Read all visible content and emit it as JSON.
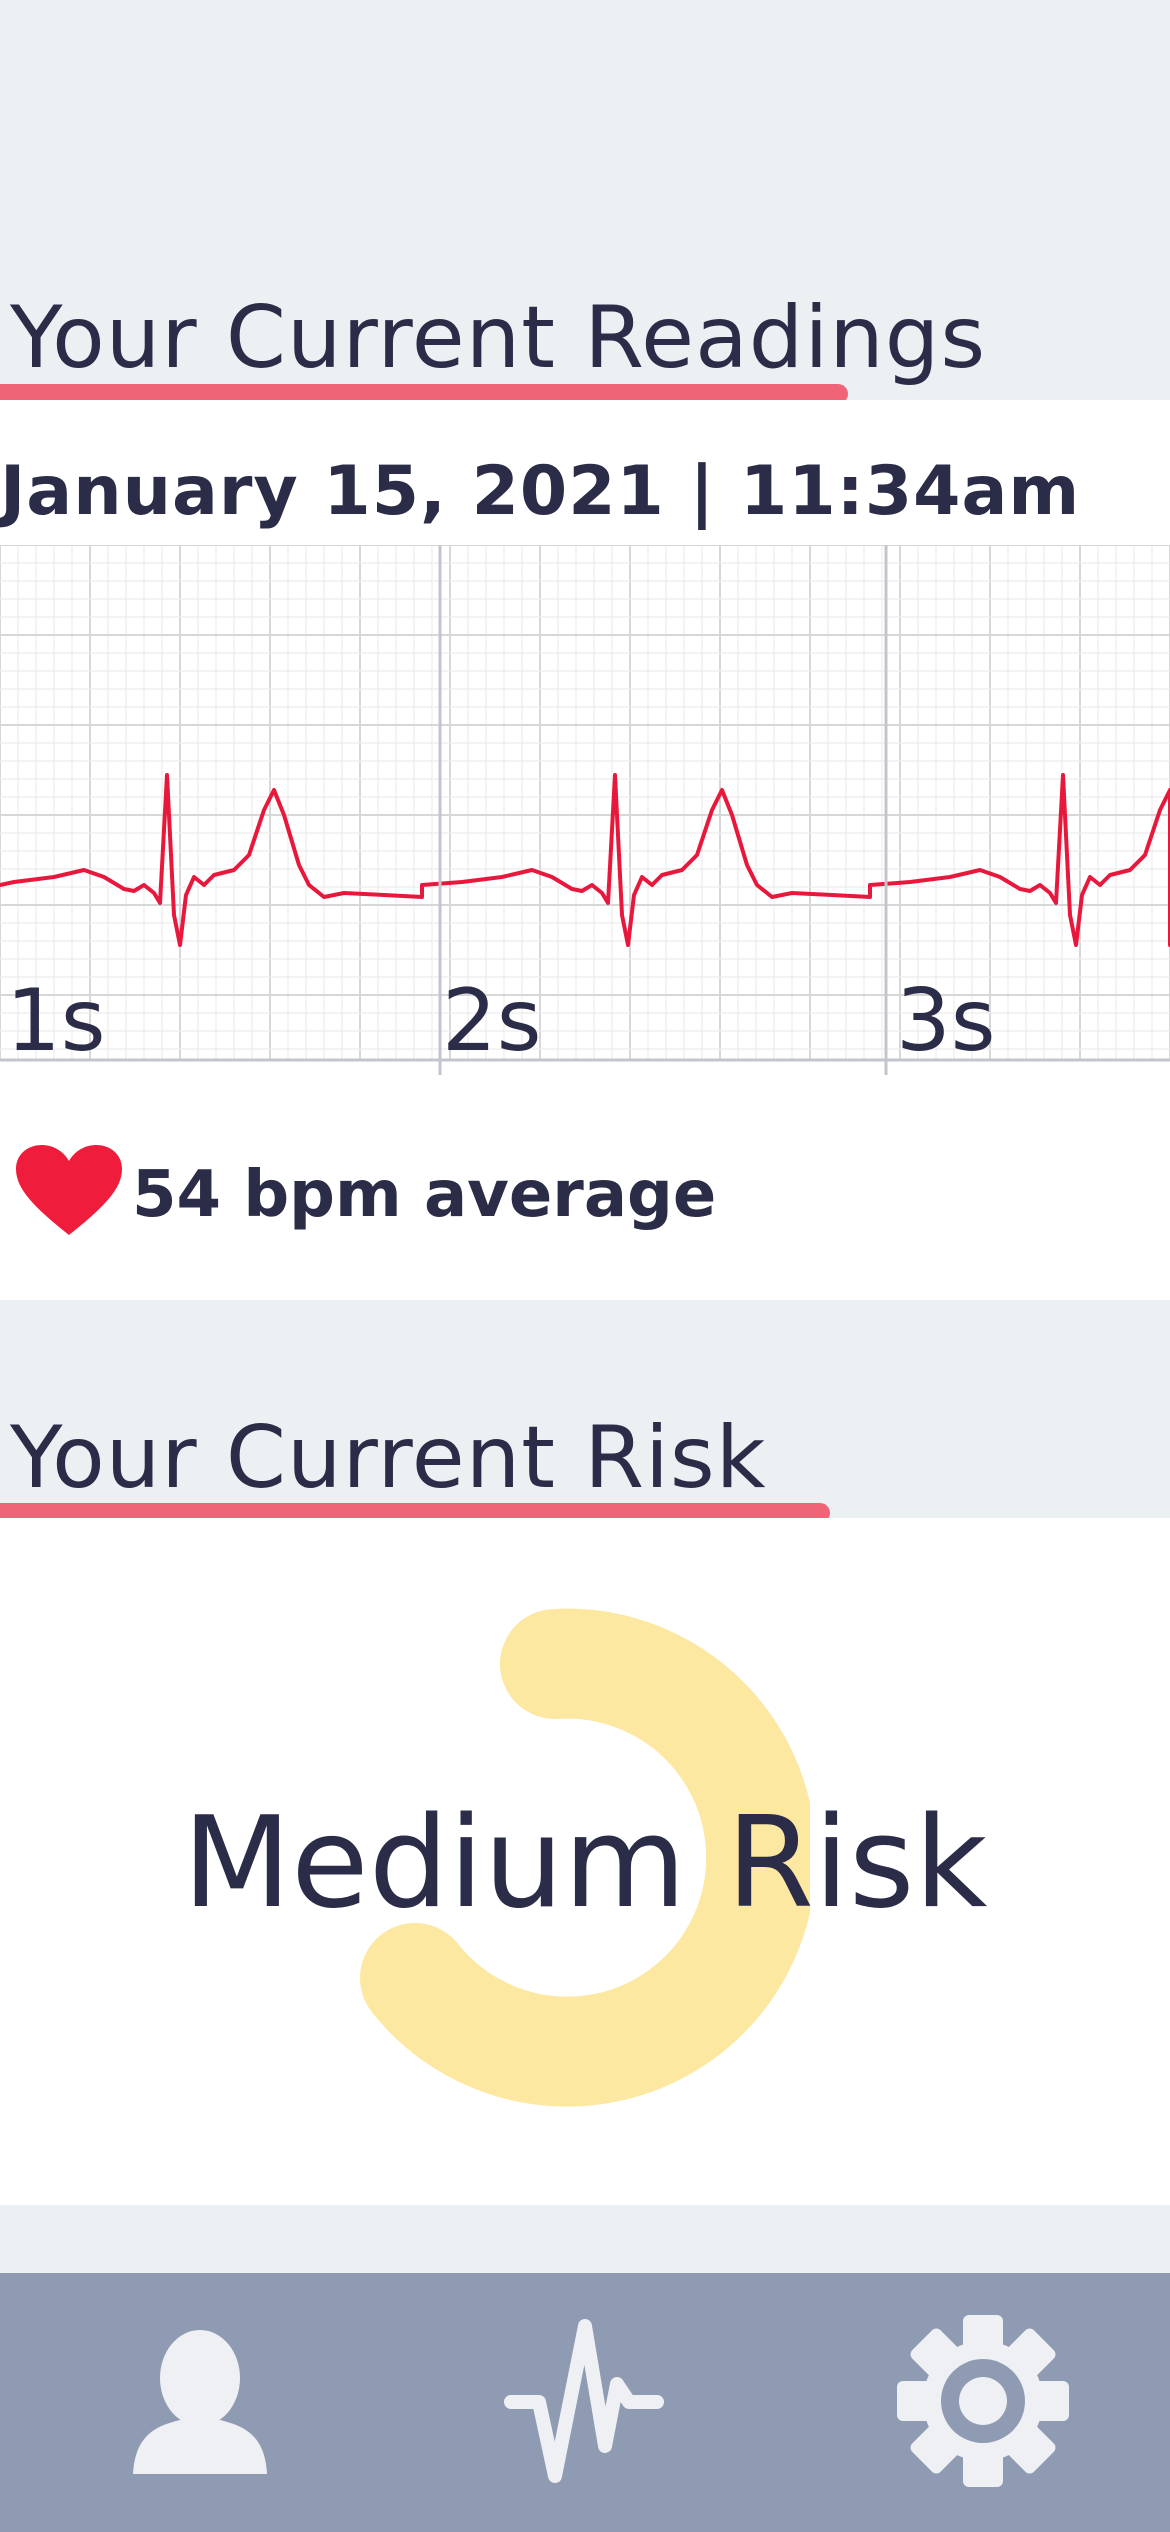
{
  "readings": {
    "title": "Your Current Readings",
    "timestamp": "January 15, 2021 | 11:34am",
    "bpm_text": "54 bpm average",
    "heart_icon": "heart-icon",
    "accent_color": "#f06477",
    "trace_color": "#e8183d"
  },
  "ecg": {
    "time_labels": [
      "1s",
      "2s",
      "3s"
    ]
  },
  "risk": {
    "title": "Your Current Risk",
    "level_label": "Medium Risk",
    "gauge_color": "#fde8a2"
  },
  "nav": {
    "items": [
      {
        "icon": "profile-icon"
      },
      {
        "icon": "heartbeat-icon"
      },
      {
        "icon": "gear-icon"
      }
    ],
    "background": "#8e9bb2",
    "icon_color": "#eef0f3"
  }
}
